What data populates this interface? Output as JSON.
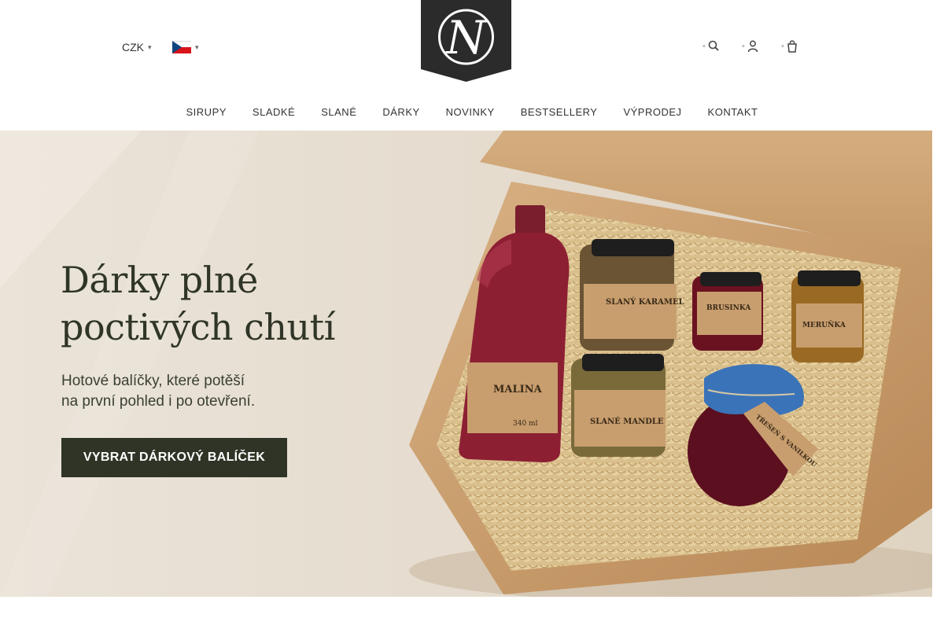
{
  "header": {
    "currency": "CZK",
    "language_flag": "czech-flag",
    "logo_letter": "N",
    "icons": [
      "search-icon",
      "user-icon",
      "cart-icon"
    ],
    "caret_glyph": "▾",
    "icon_glyphs": {
      "search": "⌕",
      "user": "◍",
      "cart": "⛍",
      "pre": "▪"
    }
  },
  "nav": {
    "items": [
      "SIRUPY",
      "SLADKÉ",
      "SLANÉ",
      "DÁRKY",
      "NOVINKY",
      "BESTSELLERY",
      "VÝPRODEJ",
      "KONTAKT"
    ]
  },
  "hero": {
    "title_line1": "Dárky plné",
    "title_line2": "poctivých chutí",
    "subtitle_line1": "Hotové balíčky, které potěší",
    "subtitle_line2": "na první pohled i po otevření.",
    "cta": "VYBRAT DÁRKOVÝ BALÍČEK"
  },
  "products": {
    "bottle_label": "MALINA",
    "bottle_volume": "340 ml",
    "jar1": "SLANÝ KARAMEL",
    "jar2": "BRUSINKA",
    "jar3": "MERUŇKA",
    "jar4": "SLANÉ MANDLE",
    "tag": "TŘEŠEŇ S VANILKOU"
  },
  "colors": {
    "dark_green": "#2f3426",
    "hero_bg": "#e7dfd2",
    "box": "#c79a66",
    "logo_bg": "#2b2b2b"
  }
}
